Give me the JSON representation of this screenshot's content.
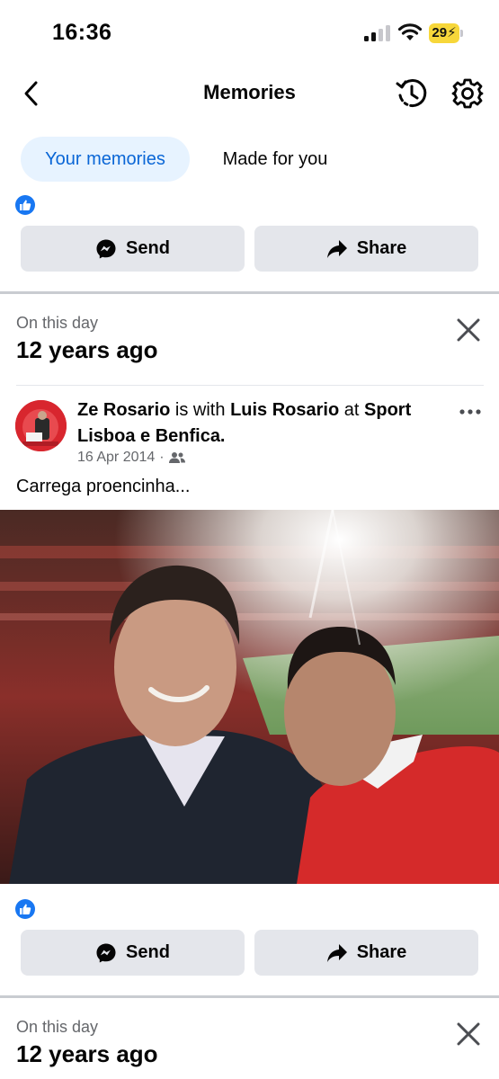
{
  "status_bar": {
    "time": "16:36",
    "battery": "29",
    "icons": [
      "signal-icon",
      "wifi-icon",
      "battery-charging-icon"
    ]
  },
  "header": {
    "title": "Memories",
    "icons": [
      "back-arrow-icon",
      "history-icon",
      "settings-gear-icon"
    ]
  },
  "tabs": [
    {
      "label": "Your memories",
      "active": true
    },
    {
      "label": "Made for you",
      "active": false
    }
  ],
  "actions": {
    "send_label": "Send",
    "share_label": "Share"
  },
  "memories": [
    {
      "label": "On this day",
      "title": "12 years ago",
      "post": {
        "author": "Ze Rosario",
        "connector": "is with",
        "with": "Luis Rosario",
        "at": "at",
        "place": "Sport Lisboa e Benfica.",
        "date": "16 Apr 2014",
        "separator": "·",
        "audience_icon": "friends-icon",
        "caption": "Carrega proencinha..."
      }
    },
    {
      "label": "On this day",
      "title": "12 years ago"
    }
  ],
  "colors": {
    "accent": "#0a66d6",
    "accent_bg": "#e7f3ff",
    "like_blue": "#1877f2",
    "button_bg": "#e4e6eb",
    "secondary_text": "#65676b",
    "divider": "#c9ccd1"
  }
}
